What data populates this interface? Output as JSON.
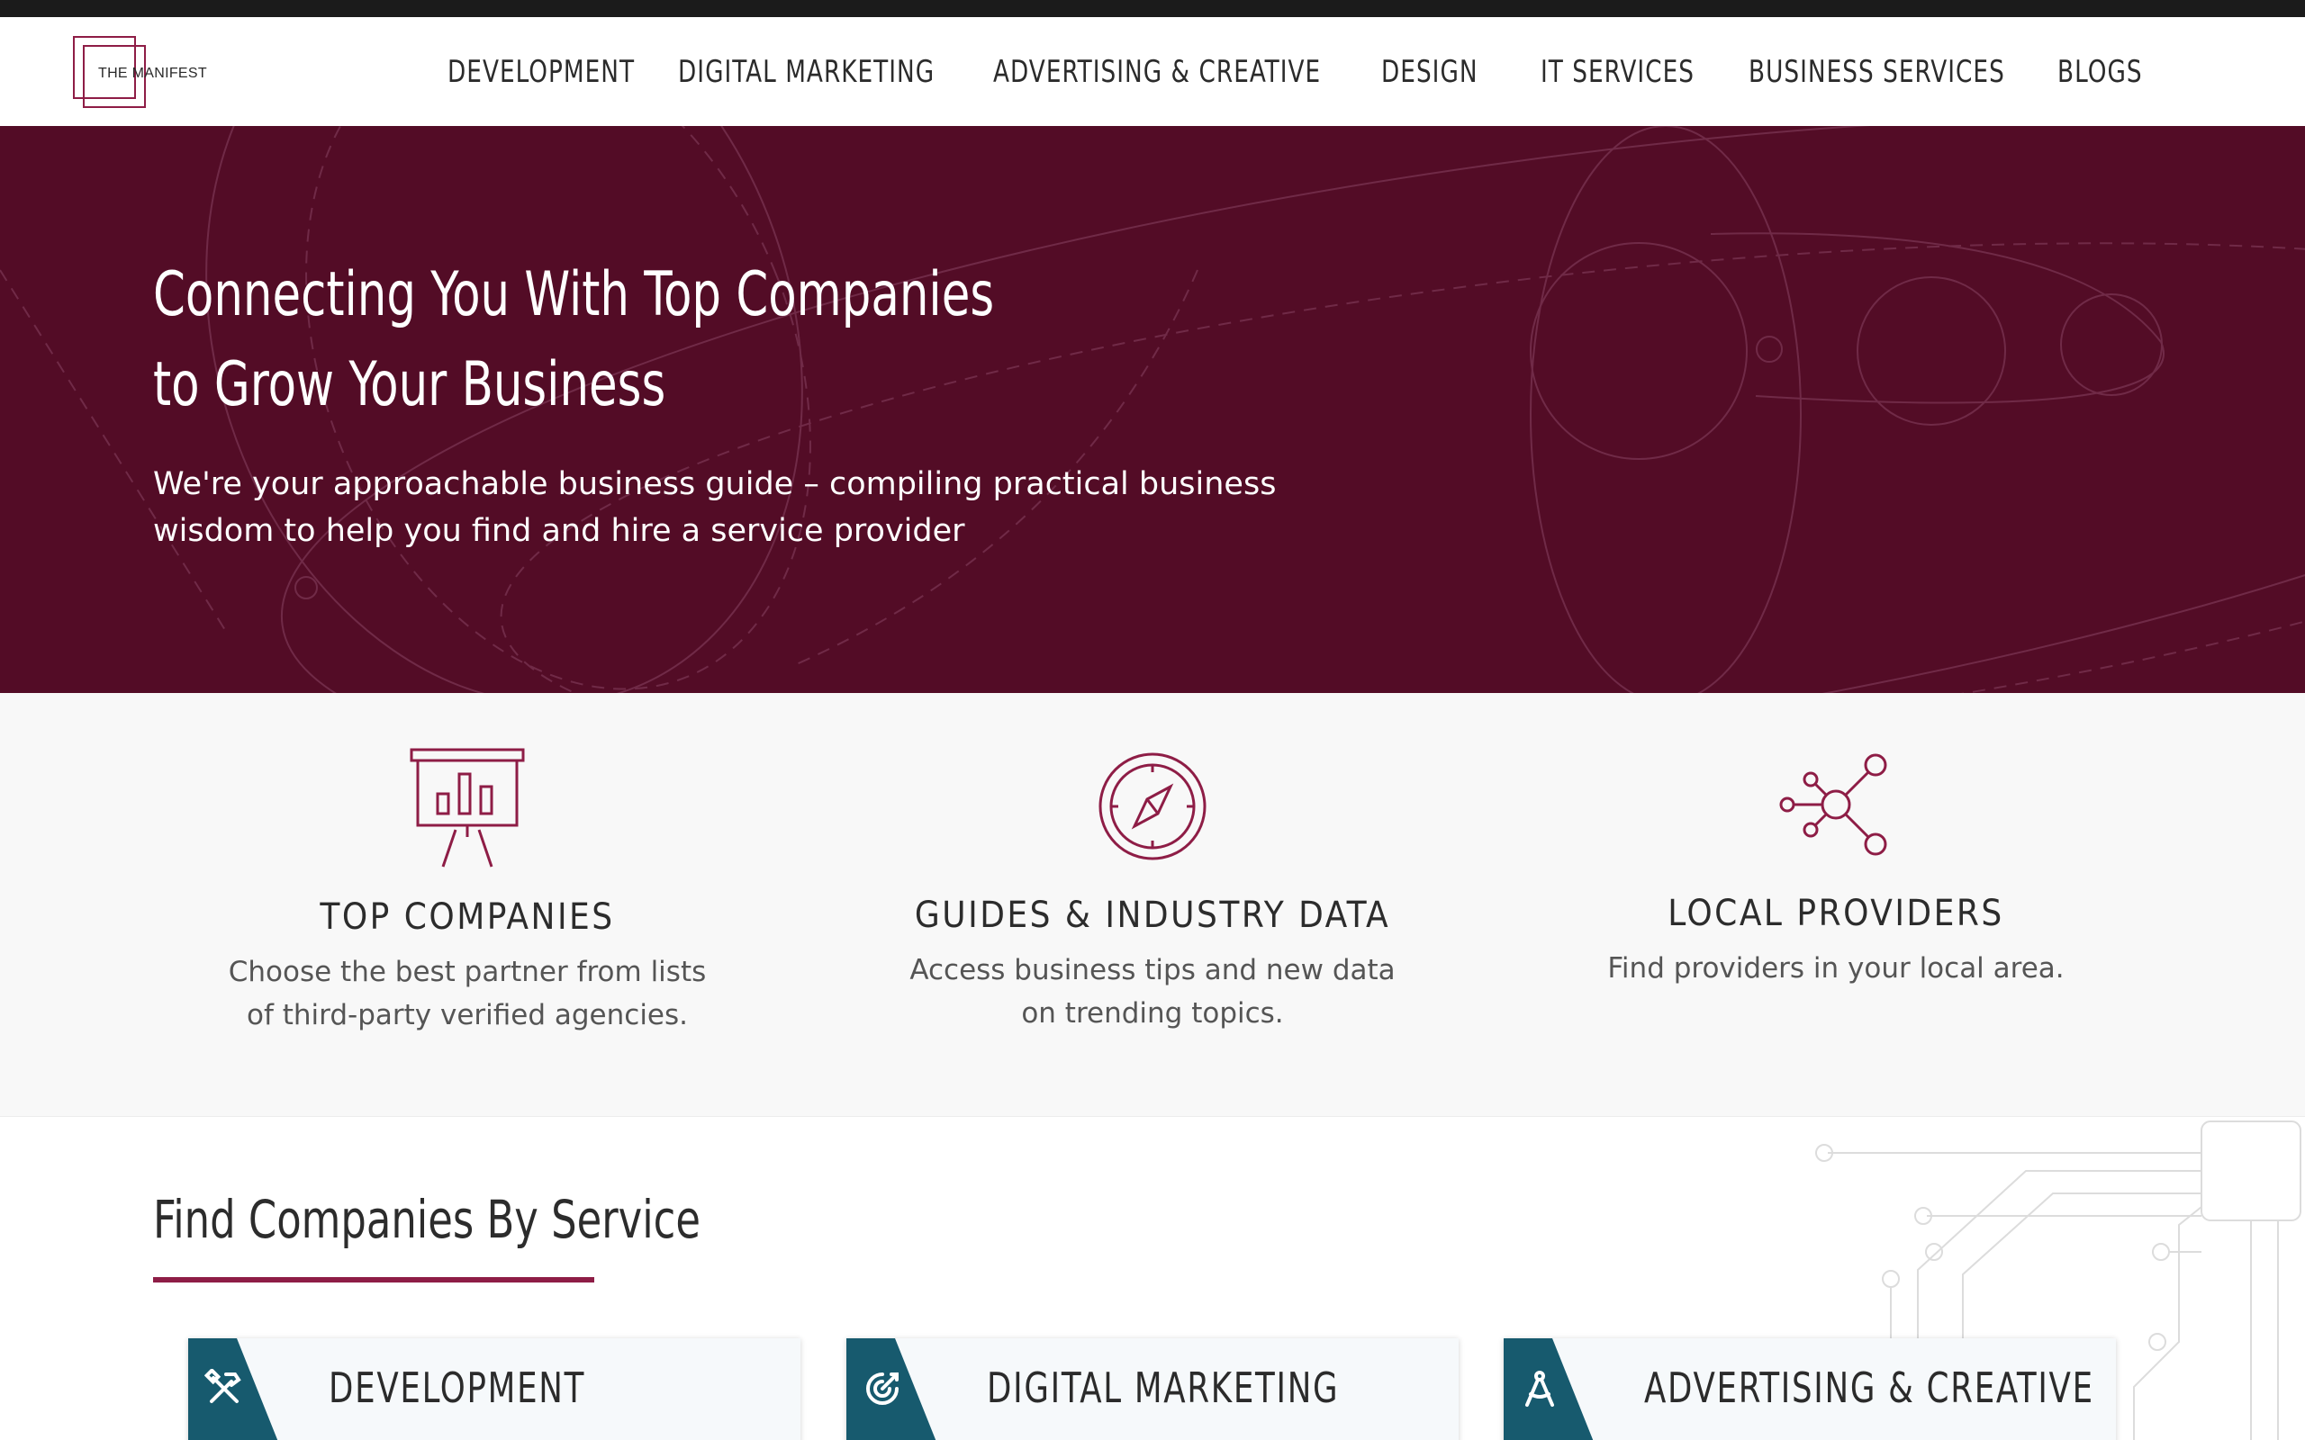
{
  "brand": {
    "logo_text": "THE MANIFEST",
    "accent": "#8e1d46",
    "hero_bg": "#530c26",
    "tab_color": "#175a6e"
  },
  "nav": {
    "items": [
      {
        "label": "DEVELOPMENT"
      },
      {
        "label": "DIGITAL MARKETING"
      },
      {
        "label": "ADVERTISING & CREATIVE"
      },
      {
        "label": "DESIGN"
      },
      {
        "label": "IT SERVICES"
      },
      {
        "label": "BUSINESS SERVICES"
      },
      {
        "label": "BLOGS"
      }
    ]
  },
  "hero": {
    "title_line1": "Connecting You With Top Companies",
    "title_line2": "to Grow Your Business",
    "subtitle_line1": "We're your approachable business guide – compiling practical business",
    "subtitle_line2": "wisdom to help you find and hire a service provider"
  },
  "features": [
    {
      "icon": "presentation-chart-icon",
      "title": "TOP COMPANIES",
      "desc_line1": "Choose the best partner from lists",
      "desc_line2": "of third-party verified agencies."
    },
    {
      "icon": "compass-icon",
      "title": "GUIDES & INDUSTRY DATA",
      "desc_line1": "Access business tips and new data",
      "desc_line2": "on trending topics."
    },
    {
      "icon": "network-nodes-icon",
      "title": "LOCAL PROVIDERS",
      "desc_line1": "Find providers in your local area.",
      "desc_line2": ""
    }
  ],
  "services": {
    "heading": "Find Companies By Service",
    "cards": [
      {
        "icon": "tools-icon",
        "label": "DEVELOPMENT"
      },
      {
        "icon": "target-icon",
        "label": "DIGITAL MARKETING"
      },
      {
        "icon": "drafting-compass-icon",
        "label": "ADVERTISING & CREATIVE"
      }
    ]
  }
}
